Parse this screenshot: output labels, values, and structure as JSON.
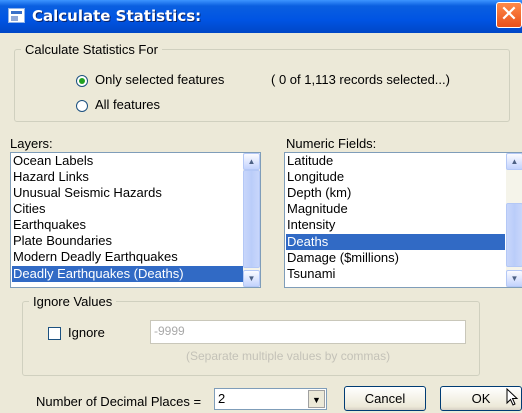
{
  "window": {
    "title": "Calculate Statistics:",
    "close_glyph": "✕"
  },
  "calc_for": {
    "legend": "Calculate Statistics For",
    "option_selected": "Only selected features",
    "option_all": "All features",
    "selected_choice": "Only selected features",
    "records_note": "( 0 of 1,113 records selected...)"
  },
  "layers": {
    "label": "Layers:",
    "items": [
      "Ocean Labels",
      "Hazard Links",
      "Unusual Seismic Hazards",
      "Cities",
      "Earthquakes",
      "Plate Boundaries",
      "Modern Deadly Earthquakes",
      "Deadly Earthquakes (Deaths)"
    ],
    "selected": "Deadly Earthquakes (Deaths)"
  },
  "fields": {
    "label": "Numeric Fields:",
    "items": [
      "Latitude",
      "Longitude",
      "Depth (km)",
      "Magnitude",
      "Intensity",
      "Deaths",
      "Damage ($millions)",
      "Tsunami"
    ],
    "selected": "Deaths"
  },
  "ignore": {
    "legend": "Ignore Values",
    "checkbox_label": "Ignore",
    "checked": false,
    "value": "-9999",
    "hint": "(Separate multiple values by commas)"
  },
  "decimals": {
    "label": "Number of Decimal Places =",
    "value": "2"
  },
  "buttons": {
    "cancel": "Cancel",
    "ok": "OK"
  },
  "icons": {
    "window": "window-icon",
    "close": "close-icon",
    "dropdown": "chevron-down-icon",
    "scroll_up": "arrow-up-icon",
    "scroll_down": "arrow-down-icon",
    "cursor": "mouse-pointer-icon"
  },
  "colors": {
    "title_bar": "#0054e3",
    "selection": "#316ac5",
    "close_button": "#e8501b"
  }
}
